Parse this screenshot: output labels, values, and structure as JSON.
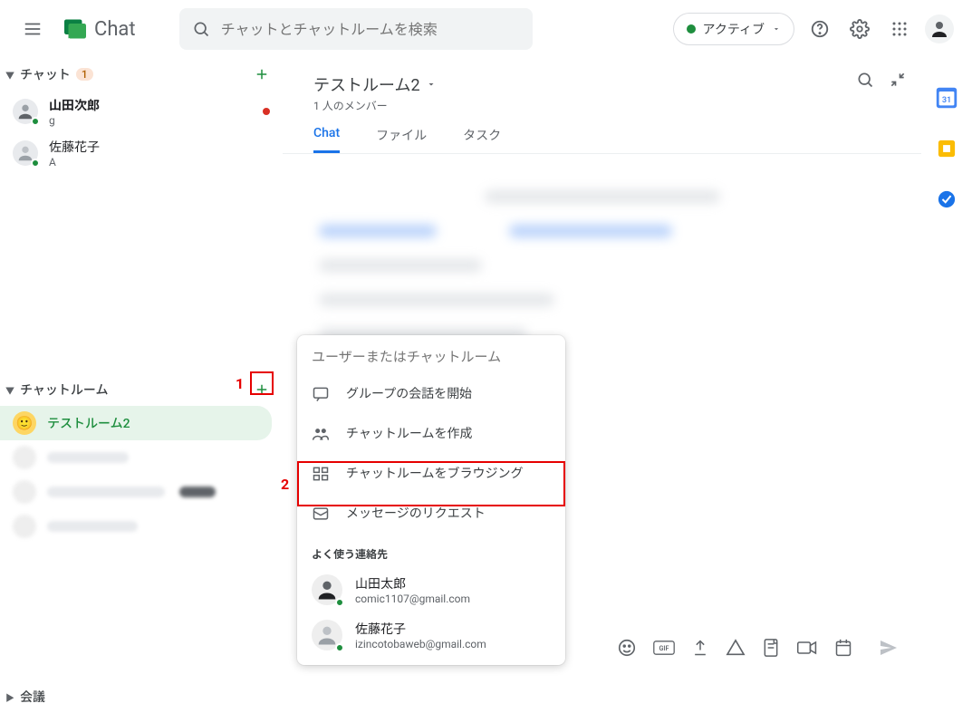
{
  "header": {
    "app_name": "Chat",
    "search_placeholder": "チャットとチャットルームを検索",
    "status_label": "アクティブ"
  },
  "sidebar": {
    "chat_section": "チャット",
    "chat_unread": "1",
    "rooms_section": "チャットルーム",
    "meet_section": "会議",
    "dms": [
      {
        "name": "山田次郎",
        "snippet": "g",
        "bold": true,
        "indicator": "#d93025"
      },
      {
        "name": "佐藤花子",
        "snippet": "A",
        "bold": false,
        "indicator": ""
      }
    ],
    "rooms": [
      {
        "name": "テストルーム2",
        "selected": true
      }
    ]
  },
  "room": {
    "title": "テストルーム2",
    "subtitle": "1 人のメンバー",
    "tabs": {
      "chat": "Chat",
      "files": "ファイル",
      "tasks": "タスク"
    }
  },
  "popup": {
    "search_placeholder": "ユーザーまたはチャットルーム",
    "items": [
      "グループの会話を開始",
      "チャットルームを作成",
      "チャットルームをブラウジング",
      "メッセージのリクエスト"
    ],
    "freq_label": "よく使う連絡先",
    "contacts": [
      {
        "name": "山田太郎",
        "email": "comic1107@gmail.com"
      },
      {
        "name": "佐藤花子",
        "email": "izincotobaweb@gmail.com"
      }
    ]
  },
  "annotations": {
    "n1": "1",
    "n2": "2"
  },
  "rail": {
    "calendar_day": "31"
  }
}
